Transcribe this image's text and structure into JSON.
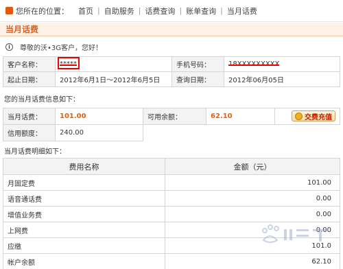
{
  "breadcrumb": {
    "location_label": "您所在的位置：",
    "items": [
      "首页",
      "自助服务",
      "话费查询",
      "账单查询",
      "当月话费"
    ]
  },
  "page_title": "当月话费",
  "greeting": "尊敬的沃•3G客户，您好！",
  "customer_info": {
    "name_label": "客户名称：",
    "name_value": "*****",
    "phone_label": "手机号码：",
    "phone_value": "18XXXXXXXXX",
    "period_label": "起止日期：",
    "period_value": "2012年6月1日～2012年6月5日",
    "query_label": "查询日期：",
    "query_value": "2012年06月05日"
  },
  "summary": {
    "section_title": "您的当月话费信息如下：",
    "current_label": "当月话费：",
    "current_value": "101.00",
    "balance_label": "可用余额：",
    "balance_value": "62.10",
    "recharge_label": "交费充值",
    "credit_label": "信用额度：",
    "credit_value": "240.00"
  },
  "detail": {
    "section_title": "当月话费明细如下：",
    "headers": [
      "费用名称",
      "金额（元）"
    ],
    "rows": [
      {
        "name": "月固定费",
        "amount": "101.00"
      },
      {
        "name": "语音通话费",
        "amount": "0.00"
      },
      {
        "name": "增值业务费",
        "amount": "0.00"
      },
      {
        "name": "上网费",
        "amount": "0.00"
      },
      {
        "name": "应缴",
        "amount": "101.0"
      },
      {
        "name": "帐户余额",
        "amount": "62.10"
      }
    ]
  },
  "colors": {
    "accent": "#e06020",
    "header_bg": "#fdf0e4"
  }
}
